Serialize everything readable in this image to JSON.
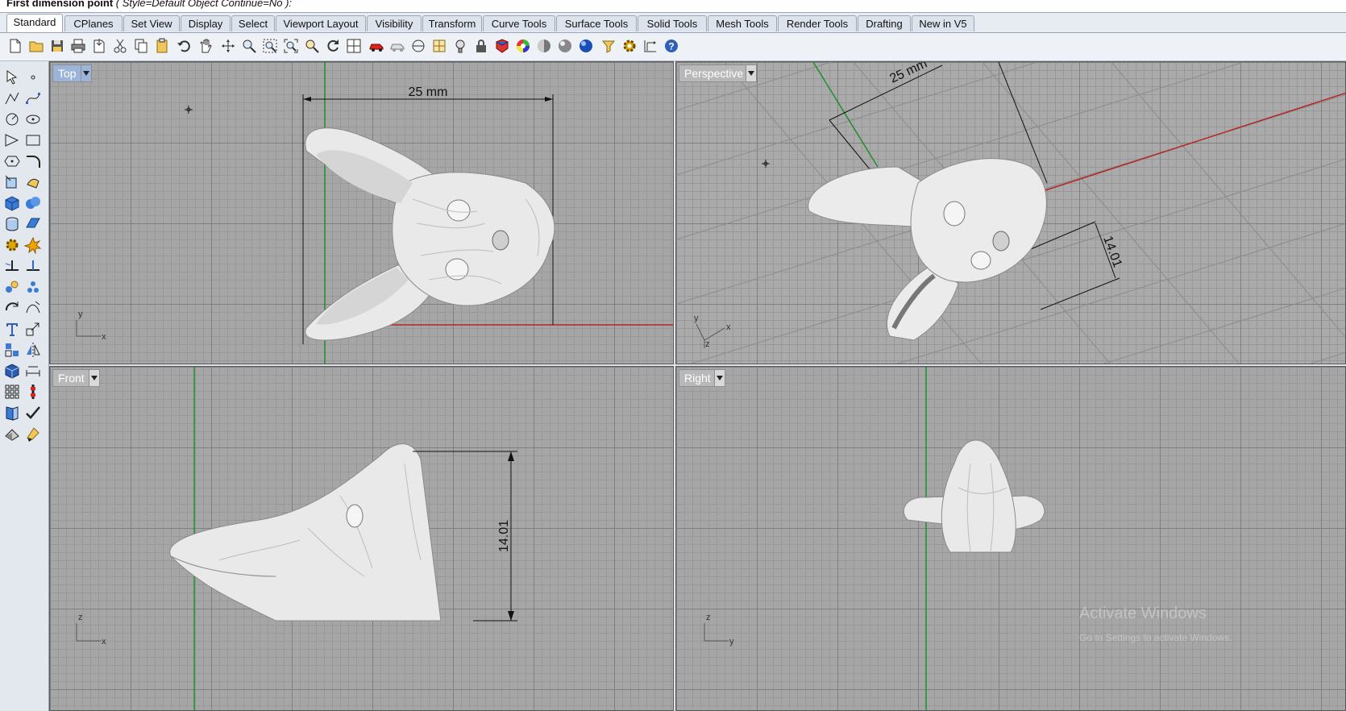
{
  "command_line": {
    "prompt": "First dimension point",
    "options": "( Style=Default  Object  Continue=No ):"
  },
  "tabs": [
    "Standard",
    "CPlanes",
    "Set View",
    "Display",
    "Select",
    "Viewport Layout",
    "Visibility",
    "Transform",
    "Curve Tools",
    "Surface Tools",
    "Solid Tools",
    "Mesh Tools",
    "Render Tools",
    "Drafting",
    "New in V5"
  ],
  "active_tab": "Standard",
  "toolbar_icons": [
    "new-icon",
    "open-icon",
    "save-icon",
    "print-icon",
    "import-icon",
    "cut-icon",
    "copy-icon",
    "paste-icon",
    "undo-icon",
    "pan-icon",
    "rotate-view-icon",
    "zoom-icon",
    "zoom-window-icon",
    "zoom-extents-icon",
    "zoom-selected-icon",
    "rotate-icon",
    "four-viewports-icon",
    "car-icon",
    "ghost-icon",
    "cplane-icon",
    "grid-snap-icon",
    "light-icon",
    "lock-icon",
    "material-icon",
    "color-wheel-icon",
    "shaded-sphere-icon",
    "rendered-sphere-icon",
    "blue-sphere-icon",
    "filter-icon",
    "settings-icon",
    "dimension-icon",
    "help-icon"
  ],
  "viewports": {
    "top": {
      "label": "Top",
      "dimension": "25 mm",
      "axis_x": "x",
      "axis_y": "y"
    },
    "perspective": {
      "label": "Perspective",
      "dimension": "25 mm",
      "dimension2": "14.01",
      "axis_x": "x",
      "axis_y": "y",
      "axis_z": "z"
    },
    "front": {
      "label": "Front",
      "dimension": "14.01",
      "axis_x": "x",
      "axis_z": "z"
    },
    "right": {
      "label": "Right",
      "axis_y": "y",
      "axis_z": "z"
    }
  },
  "watermark": {
    "line1": "Activate Windows",
    "line2": "Go to Settings to activate Windows."
  }
}
